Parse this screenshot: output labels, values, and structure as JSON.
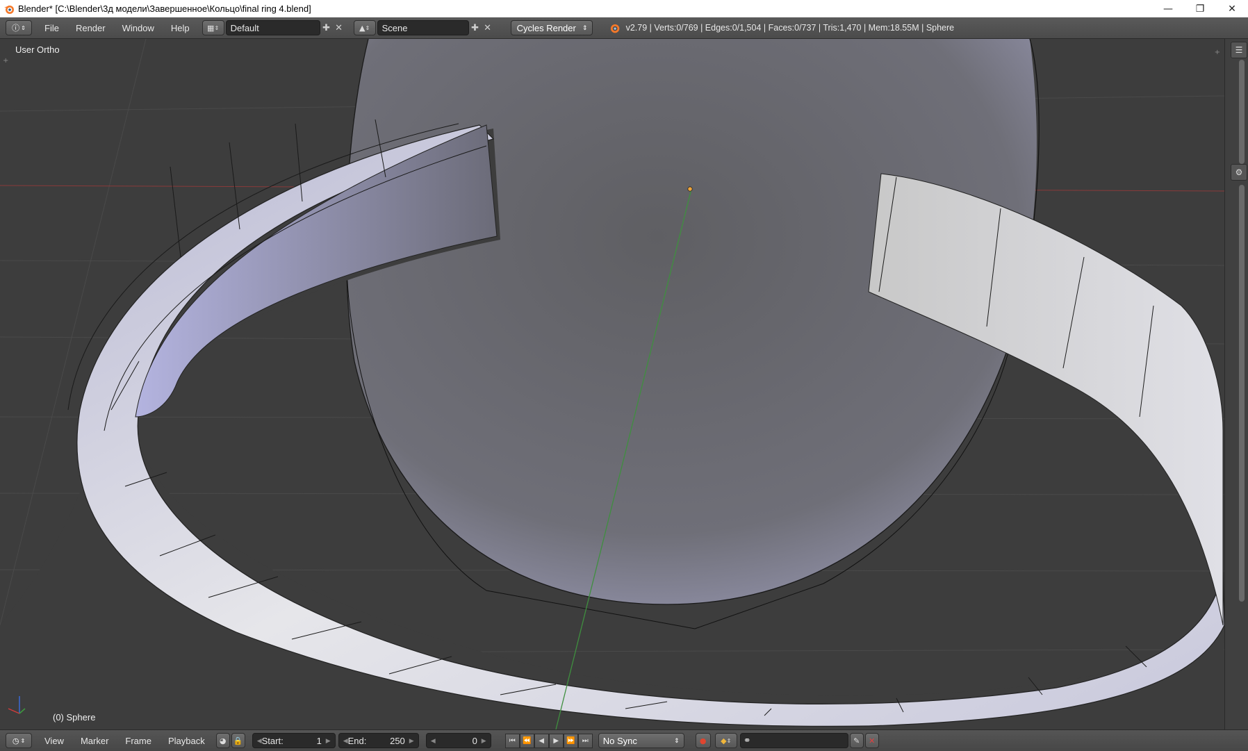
{
  "window": {
    "title": "Blender* [C:\\Blender\\3д модели\\Завершенное\\Кольцо\\final ring  4.blend]",
    "controls": [
      "minimize-icon",
      "restore-icon",
      "close-icon"
    ]
  },
  "info_header": {
    "menus": [
      "File",
      "Render",
      "Window",
      "Help"
    ],
    "screen_layout": "Default",
    "scene": "Scene",
    "render_engine": "Cycles Render",
    "stats": "v2.79 | Verts:0/769 | Edges:0/1,504 | Faces:0/737 | Tris:1,470 | Mem:18.55M | Sphere"
  },
  "viewport": {
    "view_label": "User Ortho",
    "object_label": "(0) Sphere",
    "background_color": "#3d3d3d",
    "mesh_color": "#c9c9d6"
  },
  "timeline": {
    "menus": [
      "View",
      "Marker",
      "Frame",
      "Playback"
    ],
    "start_label": "Start:",
    "start_value": "1",
    "end_label": "End:",
    "end_value": "250",
    "current_frame": "0",
    "sync": "No Sync"
  }
}
